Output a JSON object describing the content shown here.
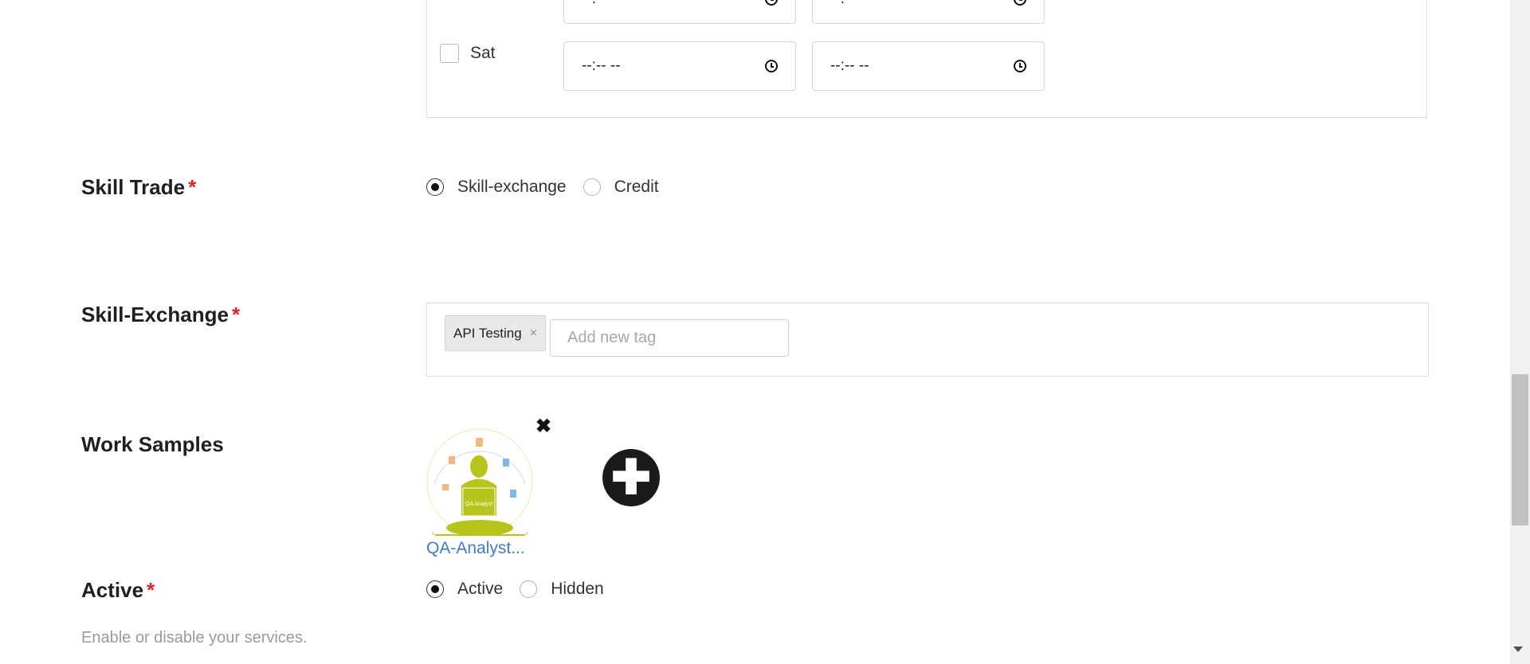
{
  "availability": {
    "time_placeholder": "--:-- --",
    "day_sat": "Sat"
  },
  "skill_trade": {
    "label": "Skill Trade",
    "required": "*",
    "options": [
      "Skill-exchange",
      "Credit"
    ],
    "selected": "Skill-exchange"
  },
  "skill_exchange": {
    "label": "Skill-Exchange",
    "required": "*",
    "tags": [
      "API Testing"
    ],
    "tag_remove": "×",
    "input_placeholder": "Add new tag"
  },
  "work_samples": {
    "label": "Work Samples",
    "remove_icon": "✖",
    "file_name": "QA-Analyst...",
    "thumb_text": "QA Analyst",
    "add_icon": "✚"
  },
  "active": {
    "label": "Active",
    "required": "*",
    "options": [
      "Active",
      "Hidden"
    ],
    "selected": "Active",
    "help": "Enable or disable your services."
  },
  "colors": {
    "required": "#d9242b",
    "link": "#3f7dc4",
    "thumb_green": "#b7c41c"
  }
}
